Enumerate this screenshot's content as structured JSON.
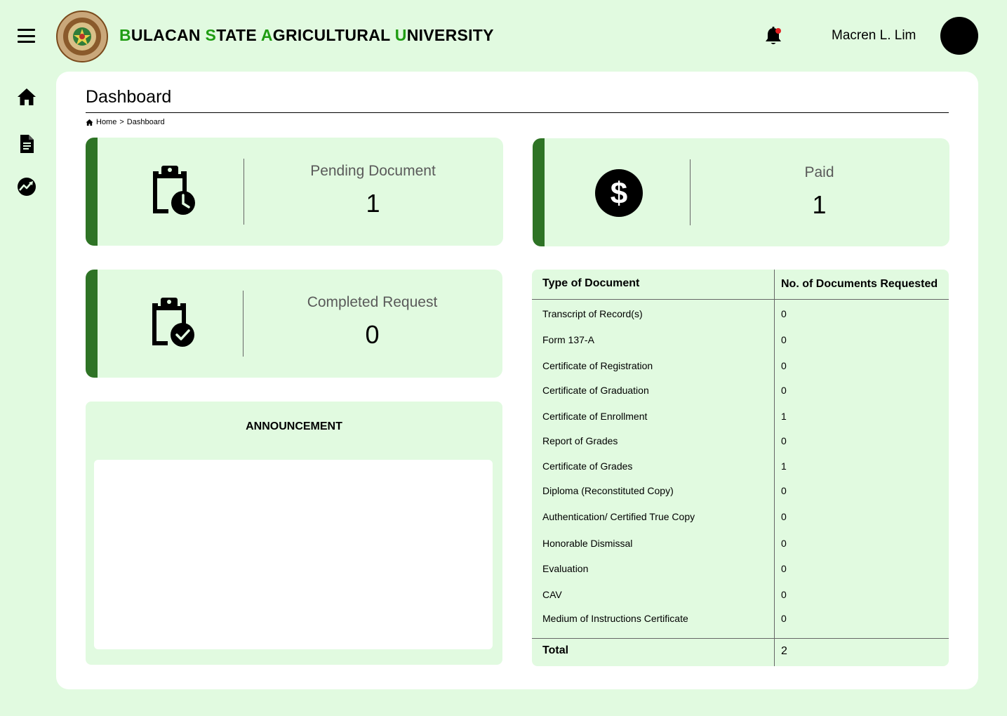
{
  "header": {
    "university": {
      "words": [
        {
          "initial": "B",
          "rest": "ULACAN"
        },
        {
          "initial": "S",
          "rest": "TATE"
        },
        {
          "initial": "A",
          "rest": "GRICULTURAL"
        },
        {
          "initial": "U",
          "rest": "NIVERSITY"
        }
      ]
    },
    "username": "Macren L. Lim"
  },
  "sidebar": {
    "items": [
      {
        "name": "home-icon"
      },
      {
        "name": "document-icon"
      },
      {
        "name": "analytics-icon"
      }
    ]
  },
  "main": {
    "title": "Dashboard",
    "breadcrumb": {
      "home": "Home",
      "separator": ">",
      "current": "Dashboard"
    }
  },
  "cards": {
    "pending": {
      "label": "Pending Document",
      "value": "1",
      "icon": "clipboard-clock-icon"
    },
    "paid": {
      "label": "Paid",
      "value": "1",
      "icon": "dollar-icon"
    },
    "completed": {
      "label": "Completed Request",
      "value": "0",
      "icon": "clipboard-check-icon"
    }
  },
  "announcement": {
    "title": "ANNOUNCEMENT"
  },
  "documents_table": {
    "headers": [
      "Type of Document",
      "No. of Documents Requested"
    ],
    "rows": [
      {
        "type": "Transcript of Record(s)",
        "count": "0"
      },
      {
        "type": "Form 137-A",
        "count": "0"
      },
      {
        "type": "Certificate of Registration",
        "count": "0"
      },
      {
        "type": "Certificate of Graduation",
        "count": "0"
      },
      {
        "type": "Certificate of Enrollment",
        "count": "1"
      },
      {
        "type": "Report of Grades",
        "count": "0"
      },
      {
        "type": "Certificate of Grades",
        "count": "1"
      },
      {
        "type": "Diploma (Reconstituted Copy)",
        "count": "0"
      },
      {
        "type": "Authentication/ Certified True Copy",
        "count": "0"
      },
      {
        "type": "Honorable Dismissal",
        "count": "0"
      },
      {
        "type": "Evaluation",
        "count": "0"
      },
      {
        "type": "CAV",
        "count": "0"
      },
      {
        "type": "Medium of Instructions Certificate",
        "count": "0"
      }
    ],
    "total": {
      "label": "Total",
      "value": "2"
    }
  },
  "colors": {
    "page_bg": "#e1fae0",
    "accent_green": "#2e7325",
    "title_initial_green": "#1f9c12",
    "notification_dot": "#e02020"
  }
}
